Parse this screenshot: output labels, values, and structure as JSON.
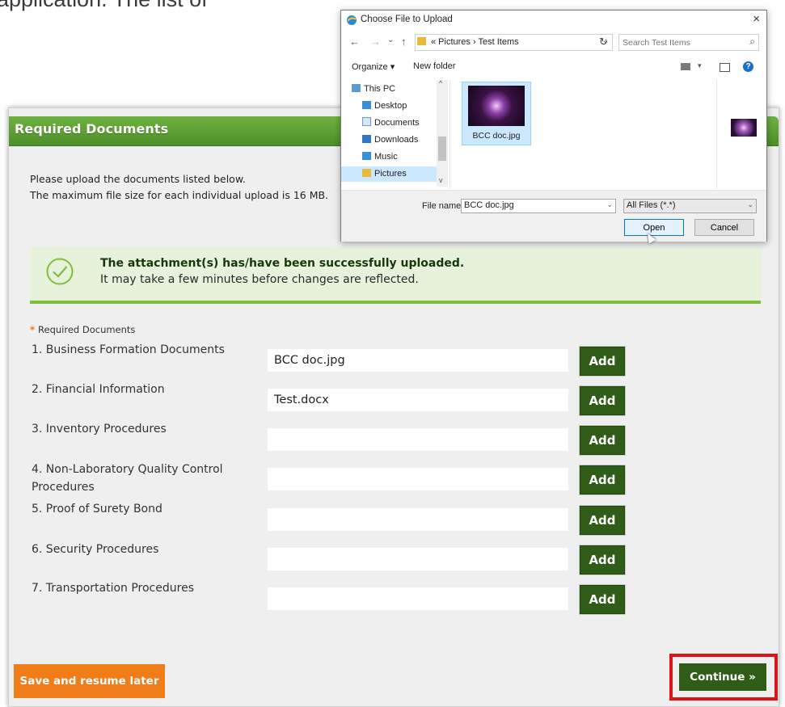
{
  "background_caption": "application. The list of",
  "panel": {
    "title": "Required Documents",
    "intro_line1": "Please upload the documents listed below.",
    "intro_line2": "The maximum file size for each individual upload is 16 MB."
  },
  "success": {
    "title": "The attachment(s) has/have been successfully uploaded.",
    "message": "It may take a few minutes before changes are reflected."
  },
  "required_legend": {
    "star": "*",
    "label": "Required Documents"
  },
  "documents": [
    {
      "label": "1. Business Formation Documents",
      "value": "BCC doc.jpg",
      "add": "Add"
    },
    {
      "label": "2. Financial Information",
      "value": "Test.docx",
      "add": "Add"
    },
    {
      "label": "3. Inventory Procedures",
      "value": "",
      "add": "Add"
    },
    {
      "label": "4. Non-Laboratory Quality Control Procedures",
      "value": "",
      "add": "Add"
    },
    {
      "label": "5. Proof of Surety Bond",
      "value": "",
      "add": "Add"
    },
    {
      "label": "6. Security Procedures",
      "value": "",
      "add": "Add"
    },
    {
      "label": "7. Transportation Procedures",
      "value": "",
      "add": "Add"
    }
  ],
  "actions": {
    "save": "Save and resume later",
    "continue": "Continue »"
  },
  "dialog": {
    "title": "Choose File to Upload",
    "close": "×",
    "back": "←",
    "forward": "→",
    "history": "⌄",
    "up": "↑",
    "path": "« Pictures › Test Items",
    "refresh": "↻",
    "search_placeholder": "Search Test Items",
    "organize": "Organize ▾",
    "new_folder": "New folder",
    "help": "?",
    "tree": [
      "This PC",
      "Desktop",
      "Documents",
      "Downloads",
      "Music",
      "Pictures"
    ],
    "file": "BCC doc.jpg",
    "filename_label": "File name:",
    "filename_value": "BCC doc.jpg",
    "filter": "All Files (*.*)",
    "open": "Open",
    "cancel": "Cancel"
  },
  "colors": {
    "header_green": "#5da535",
    "add_green": "#2f5c16",
    "save_orange": "#f07d1a",
    "highlight_red": "#e0131b",
    "success_bg": "#e7f2da"
  }
}
